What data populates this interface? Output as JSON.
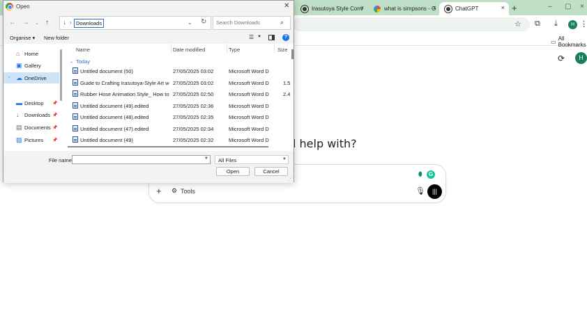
{
  "browser": {
    "tabs": [
      {
        "label": "Irasutoya Style Conv",
        "favicon_color": "#333333",
        "active": false
      },
      {
        "label": "what is simpsons - G",
        "favicon_color": "#4285f4",
        "active": false
      },
      {
        "label": "ChatGPT",
        "favicon_color": "#333333",
        "active": true
      }
    ],
    "tab_close_glyph": "×",
    "new_tab_glyph": "+",
    "window_controls": [
      "–",
      "▢",
      "×"
    ],
    "profile_initial": "H",
    "bookmarks_all_label": "All Bookmarks",
    "accent_color": "#bfe0c6"
  },
  "chatgpt": {
    "avatar_initial": "H",
    "heading": "l help with?",
    "tools_label": "Tools"
  },
  "dialog": {
    "title": "Open",
    "breadcrumb": "Downloads",
    "search_placeholder": "Search Downloads",
    "organise_label": "Organise ▾",
    "new_folder_label": "New folder",
    "nav_items": [
      {
        "label": "Home",
        "icon": "home-icon",
        "glyph": "⌂",
        "color": "#c05a1a",
        "expand": "",
        "pinned": false,
        "selected": false
      },
      {
        "label": "Gallery",
        "icon": "gallery-icon",
        "glyph": "▣",
        "color": "#1a73e8",
        "expand": "",
        "pinned": false,
        "selected": false
      },
      {
        "label": "OneDrive",
        "icon": "cloud-icon",
        "glyph": "☁",
        "color": "#1a73e8",
        "expand": "›",
        "pinned": false,
        "selected": true
      },
      {
        "label": "Desktop",
        "icon": "desktop-icon",
        "glyph": "▬",
        "color": "#1a73e8",
        "expand": "",
        "pinned": true,
        "selected": false
      },
      {
        "label": "Downloads",
        "icon": "downloads-icon",
        "glyph": "↓",
        "color": "#1a7f5a",
        "expand": "",
        "pinned": true,
        "selected": false
      },
      {
        "label": "Documents",
        "icon": "documents-icon",
        "glyph": "▤",
        "color": "#5f6b7a",
        "expand": "",
        "pinned": true,
        "selected": false
      },
      {
        "label": "Pictures",
        "icon": "pictures-icon",
        "glyph": "▨",
        "color": "#1a73e8",
        "expand": "",
        "pinned": true,
        "selected": false
      }
    ],
    "columns": {
      "name": "Name",
      "date": "Date modified",
      "type": "Type",
      "size": "Size"
    },
    "group_label": "Today",
    "files": [
      {
        "name": "Untitled document (50)",
        "date": "27/05/2025 03:02",
        "type": "Microsoft Word D...",
        "size": ""
      },
      {
        "name": "Guide to Crafting Irasutoya-Style Art with...",
        "date": "27/05/2025 03:02",
        "type": "Microsoft Word D...",
        "size": "1.5"
      },
      {
        "name": "Rubber Hose Animation Style_ How to R...",
        "date": "27/05/2025 02:50",
        "type": "Microsoft Word D...",
        "size": "2.4"
      },
      {
        "name": "Untitled document (49).edited",
        "date": "27/05/2025 02:36",
        "type": "Microsoft Word D...",
        "size": ""
      },
      {
        "name": "Untitled document (48).edited",
        "date": "27/05/2025 02:35",
        "type": "Microsoft Word D...",
        "size": ""
      },
      {
        "name": "Untitled document (47).edited",
        "date": "27/05/2025 02:34",
        "type": "Microsoft Word D...",
        "size": ""
      },
      {
        "name": "Untitled document (49)",
        "date": "27/05/2025 02:32",
        "type": "Microsoft Word D...",
        "size": ""
      }
    ],
    "file_name_label": "File name:",
    "file_name_value": "",
    "filter_value": "All Files",
    "open_label": "Open",
    "cancel_label": "Cancel"
  }
}
